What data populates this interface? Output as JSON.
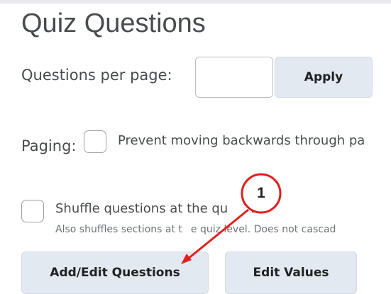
{
  "page": {
    "title": "Quiz Questions"
  },
  "questions_per_page": {
    "label": "Questions per page:",
    "value": "",
    "apply_label": "Apply"
  },
  "paging": {
    "label": "Paging:",
    "checked": false,
    "option_text": "Prevent moving backwards through pa"
  },
  "shuffle": {
    "checked": false,
    "label_part1": "Shuffle questions at the qu",
    "label_part2": "vel",
    "help_part1": "Also shuffles sections at t",
    "help_part2": "e quiz level. Does not cascad"
  },
  "actions": {
    "add_edit_label": "Add/Edit Questions",
    "edit_values_label": "Edit Values"
  },
  "callout": {
    "number": "1",
    "color": "#e0201c"
  },
  "colors": {
    "button_bg": "#e3e9f1",
    "text": "#494c4e"
  }
}
